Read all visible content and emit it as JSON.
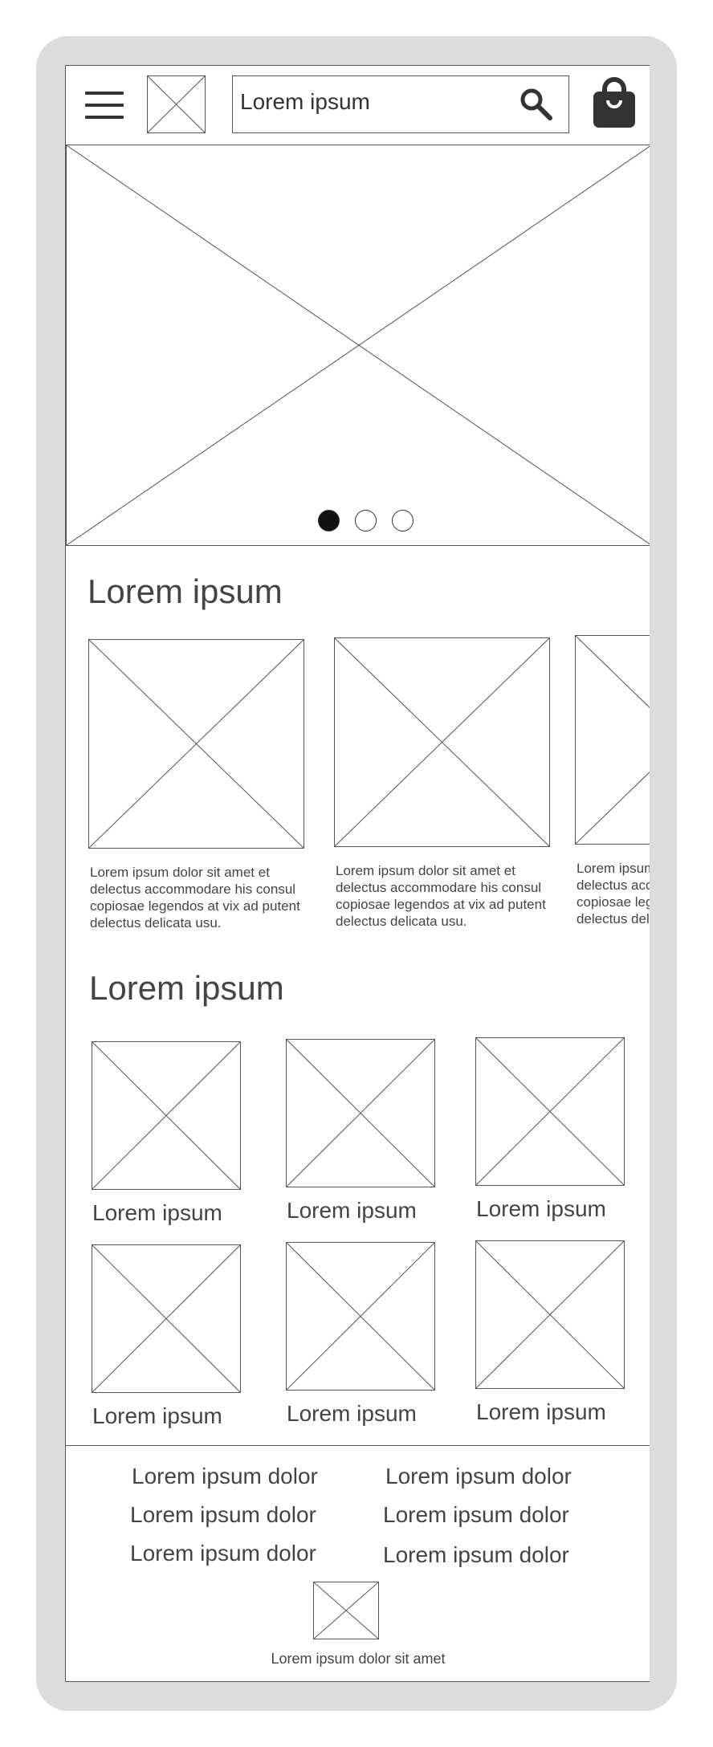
{
  "header": {
    "search": {
      "value": "Lorem ipsum"
    }
  },
  "carousel": {
    "slide_count": 3,
    "active_index": 0
  },
  "featured": {
    "title": "Lorem ipsum",
    "cards": [
      {
        "description": "Lorem ipsum dolor sit amet et delectus accommodare his consul copiosae legendos at vix ad putent delectus delicata usu."
      },
      {
        "description": "Lorem ipsum dolor sit amet et delectus accommodare his consul copiosae legendos at vix ad putent delectus delicata usu."
      },
      {
        "description": "Lorem ipsum dolor sit amet et delectus accommodare his consul copiosae legendos at vix ad putent delectus delicata usu."
      }
    ]
  },
  "grid": {
    "title": "Lorem ipsum",
    "items": [
      {
        "label": "Lorem ipsum"
      },
      {
        "label": "Lorem ipsum"
      },
      {
        "label": "Lorem ipsum"
      },
      {
        "label": "Lorem ipsum"
      },
      {
        "label": "Lorem ipsum"
      },
      {
        "label": "Lorem ipsum"
      }
    ]
  },
  "footer": {
    "links": [
      "Lorem ipsum dolor",
      "Lorem ipsum dolor",
      "Lorem ipsum dolor",
      "Lorem ipsum dolor",
      "Lorem ipsum dolor",
      "Lorem ipsum dolor"
    ],
    "caption": "Lorem ipsum dolor sit amet"
  },
  "colors": {
    "frame": "#dcdcdc",
    "stroke": "#555555",
    "text": "#444444",
    "icon": "#333333",
    "dot_active": "#111111"
  },
  "icons": {
    "menu": "hamburger-icon",
    "search": "search-icon",
    "cart": "shopping-bag-icon"
  }
}
